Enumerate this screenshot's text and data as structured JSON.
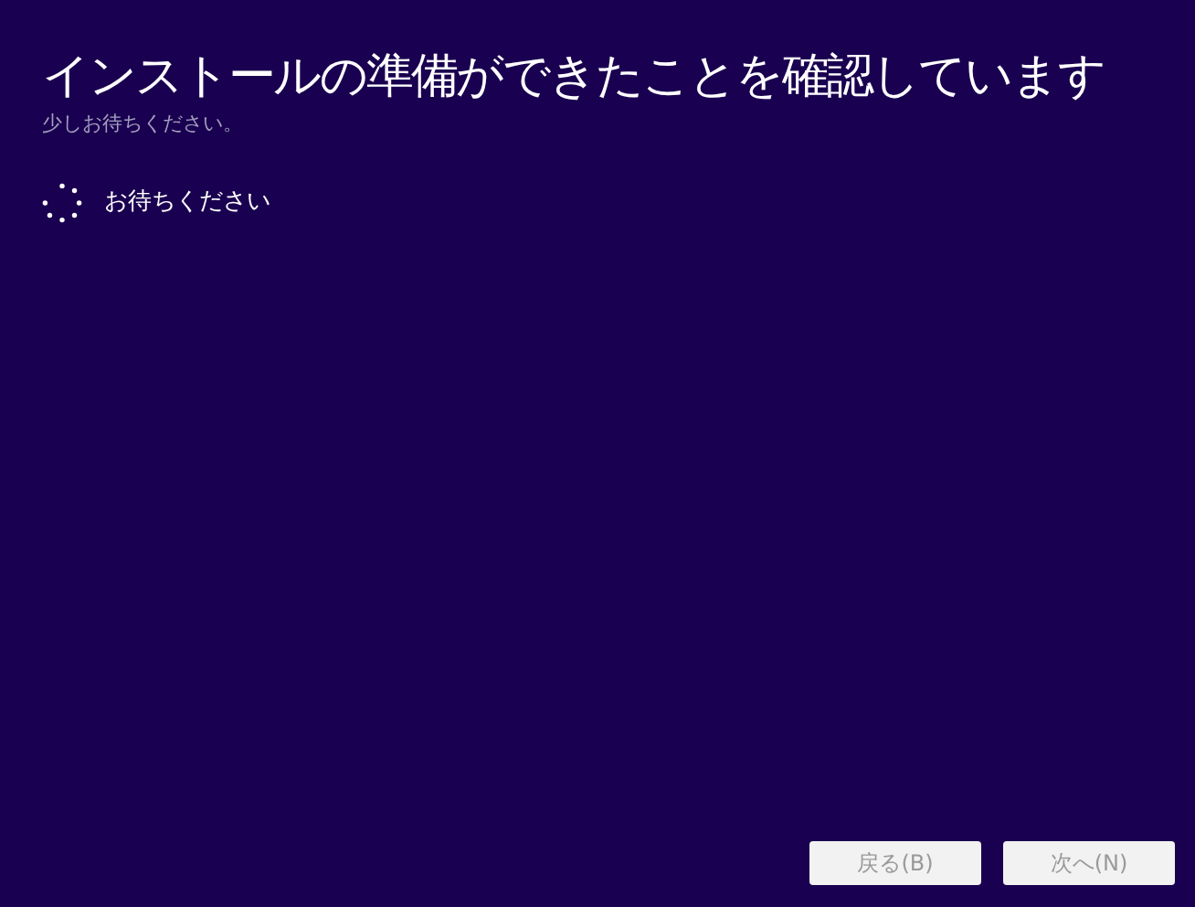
{
  "title": "インストールの準備ができたことを確認しています",
  "subtitle": "少しお待ちください。",
  "status": {
    "text": "お待ちください"
  },
  "buttons": [
    {
      "label": "戻る(B)",
      "disabled": true
    },
    {
      "label": "次へ(N)",
      "disabled": true
    }
  ]
}
